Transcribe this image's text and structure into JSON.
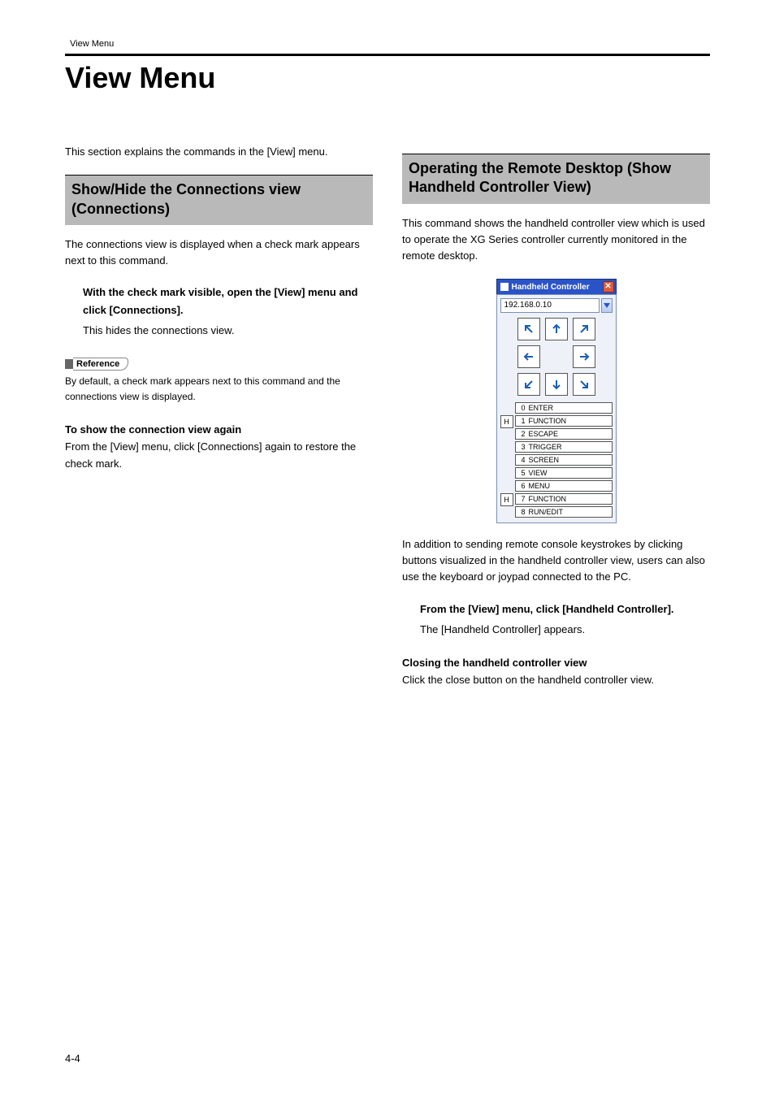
{
  "running_head": "View Menu",
  "page_title": "View Menu",
  "left": {
    "intro": "This section explains the commands in the [View] menu.",
    "section_title": "Show/Hide the Connections view (Connections)",
    "section_body": "The connections view is displayed when a check mark appears next to this command.",
    "step_title": "With the check mark visible, open the [View] menu and click [Connections].",
    "step_body": "This hides the connections view.",
    "reference_label": "Reference",
    "reference_body": "By default, a check mark appears next to this command and the connections view is displayed.",
    "sub_head": "To show the connection view again",
    "sub_body": "From the [View] menu, click [Connections] again to restore the check mark."
  },
  "right": {
    "section_title": "Operating the Remote Desktop (Show Handheld Controller View)",
    "section_body": "This command shows the handheld controller view which is used to operate the XG Series controller currently monitored in the remote desktop.",
    "after_figure": "In addition to sending remote console keystrokes by clicking buttons visualized in the handheld controller view, users can also use the keyboard or joypad connected to the PC.",
    "step_title": "From the [View] menu, click [Handheld Controller].",
    "step_body": "The [Handheld Controller] appears.",
    "sub_head": "Closing the handheld controller view",
    "sub_body": "Click the close button on the handheld controller view."
  },
  "handheld": {
    "title": "Handheld Controller",
    "close_glyph": "✕",
    "ip": "192.168.0.10",
    "h_badge": "H",
    "menu": [
      {
        "n": "0",
        "label": "ENTER"
      },
      {
        "n": "1",
        "label": "FUNCTION"
      },
      {
        "n": "2",
        "label": "ESCAPE"
      },
      {
        "n": "3",
        "label": "TRIGGER"
      },
      {
        "n": "4",
        "label": "SCREEN"
      },
      {
        "n": "5",
        "label": "VIEW"
      },
      {
        "n": "6",
        "label": "MENU"
      },
      {
        "n": "7",
        "label": "FUNCTION"
      },
      {
        "n": "8",
        "label": "RUN/EDIT"
      }
    ],
    "h_rows": [
      1,
      7
    ]
  },
  "page_number": "4-4"
}
